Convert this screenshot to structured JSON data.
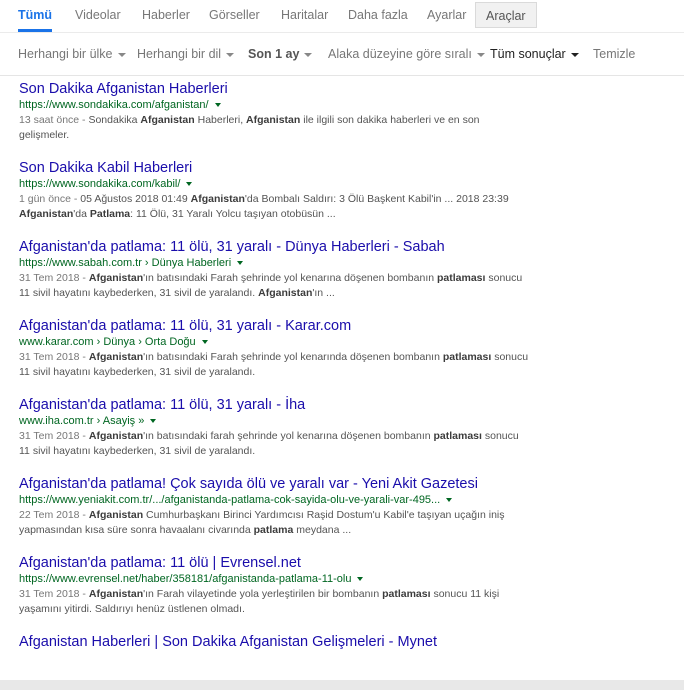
{
  "tabs": [
    {
      "label": "Tümü"
    },
    {
      "label": "Videolar"
    },
    {
      "label": "Haberler"
    },
    {
      "label": "Görseller"
    },
    {
      "label": "Haritalar"
    },
    {
      "label": "Daha fazla"
    },
    {
      "label": "Ayarlar"
    },
    {
      "label": "Araçlar"
    }
  ],
  "filters": {
    "country": "Herhangi bir ülke",
    "language": "Herhangi bir dil",
    "time": "Son 1 ay",
    "sort": "Alaka düzeyine göre sıralı",
    "all_results": "Tüm sonuçlar",
    "clear": "Temizle"
  },
  "results": [
    {
      "title": "Son Dakika Afganistan Haberleri",
      "url": "https://www.sondakika.com/afganistan/",
      "snippet_parts": [
        {
          "t": "13 saat önce - ",
          "c": "date"
        },
        {
          "t": "Sondakika ",
          "c": ""
        },
        {
          "t": "Afganistan",
          "c": "b"
        },
        {
          "t": " Haberleri, ",
          "c": ""
        },
        {
          "t": "Afganistan",
          "c": "b"
        },
        {
          "t": " ile ilgili son dakika haberleri ve en son gelişmeler.",
          "c": ""
        }
      ]
    },
    {
      "title": "Son Dakika Kabil Haberleri",
      "url": "https://www.sondakika.com/kabil/",
      "snippet_parts": [
        {
          "t": "1 gün önce - ",
          "c": "date"
        },
        {
          "t": "05 Ağustos 2018 01:49 ",
          "c": ""
        },
        {
          "t": "Afganistan",
          "c": "b"
        },
        {
          "t": "'da Bombalı Saldırı: 3 Ölü Başkent Kabil'in ... 2018 23:39 ",
          "c": ""
        },
        {
          "t": "Afganistan",
          "c": "b"
        },
        {
          "t": "'da ",
          "c": ""
        },
        {
          "t": "Patlama",
          "c": "b"
        },
        {
          "t": ": 11 Ölü, 31 Yaralı Yolcu taşıyan otobüsün ...",
          "c": ""
        }
      ]
    },
    {
      "title": "Afganistan'da patlama: 11 ölü, 31 yaralı - Dünya Haberleri - Sabah",
      "url": "https://www.sabah.com.tr › Dünya Haberleri",
      "snippet_parts": [
        {
          "t": "31 Tem 2018 - ",
          "c": "date"
        },
        {
          "t": "Afganistan",
          "c": "b"
        },
        {
          "t": "'ın batısındaki Farah şehrinde yol kenarına döşenen bombanın ",
          "c": ""
        },
        {
          "t": "patlaması",
          "c": "b"
        },
        {
          "t": " sonucu 11 sivil hayatını kaybederken, 31 sivil de yaralandı. ",
          "c": ""
        },
        {
          "t": "Afganistan",
          "c": "b"
        },
        {
          "t": "'ın ...",
          "c": ""
        }
      ]
    },
    {
      "title": "Afganistan'da patlama: 11 ölü, 31 yaralı - Karar.com",
      "url": "www.karar.com › Dünya › Orta Doğu",
      "snippet_parts": [
        {
          "t": "31 Tem 2018 - ",
          "c": "date"
        },
        {
          "t": "Afganistan",
          "c": "b"
        },
        {
          "t": "'ın batısındaki Farah şehrinde yol kenarında döşenen bombanın ",
          "c": ""
        },
        {
          "t": "patlaması",
          "c": "b"
        },
        {
          "t": " sonucu 11 sivil hayatını kaybederken, 31 sivil de yaralandı.",
          "c": ""
        }
      ]
    },
    {
      "title": "Afganistan'da patlama: 11 ölü, 31 yaralı - İha",
      "url": "www.iha.com.tr › Asayiş »",
      "snippet_parts": [
        {
          "t": "31 Tem 2018 - ",
          "c": "date"
        },
        {
          "t": "Afganistan",
          "c": "b"
        },
        {
          "t": "'ın batısındaki farah şehrinde yol kenarına döşenen bombanın ",
          "c": ""
        },
        {
          "t": "patlaması",
          "c": "b"
        },
        {
          "t": " sonucu 11 sivil hayatını kaybederken, 31 sivil de yaralandı.",
          "c": ""
        }
      ]
    },
    {
      "title": "Afganistan'da patlama! Çok sayıda ölü ve yaralı var - Yeni Akit Gazetesi",
      "url": "https://www.yeniakit.com.tr/.../afganistanda-patlama-cok-sayida-olu-ve-yarali-var-495...",
      "snippet_parts": [
        {
          "t": "22 Tem 2018 - ",
          "c": "date"
        },
        {
          "t": "Afganistan",
          "c": "b"
        },
        {
          "t": " Cumhurbaşkanı Birinci Yardımcısı Raşid Dostum'u Kabil'e taşıyan uçağın iniş yapmasından kısa süre sonra havaalanı civarında ",
          "c": ""
        },
        {
          "t": "patlama",
          "c": "b"
        },
        {
          "t": " meydana ...",
          "c": ""
        }
      ]
    },
    {
      "title": "Afganistan'da patlama: 11 ölü | Evrensel.net",
      "url": "https://www.evrensel.net/haber/358181/afganistanda-patlama-11-olu",
      "snippet_parts": [
        {
          "t": "31 Tem 2018 - ",
          "c": "date"
        },
        {
          "t": "Afganistan",
          "c": "b"
        },
        {
          "t": "'ın Farah vilayetinde yola yerleştirilen bir bombanın ",
          "c": ""
        },
        {
          "t": "patlaması",
          "c": "b"
        },
        {
          "t": " sonucu 11 kişi yaşamını yitirdi. Saldırıyı henüz üstlenen olmadı.",
          "c": ""
        }
      ]
    },
    {
      "title": "Afganistan Haberleri | Son Dakika Afganistan Gelişmeleri - Mynet",
      "url": "",
      "snippet_parts": []
    }
  ]
}
